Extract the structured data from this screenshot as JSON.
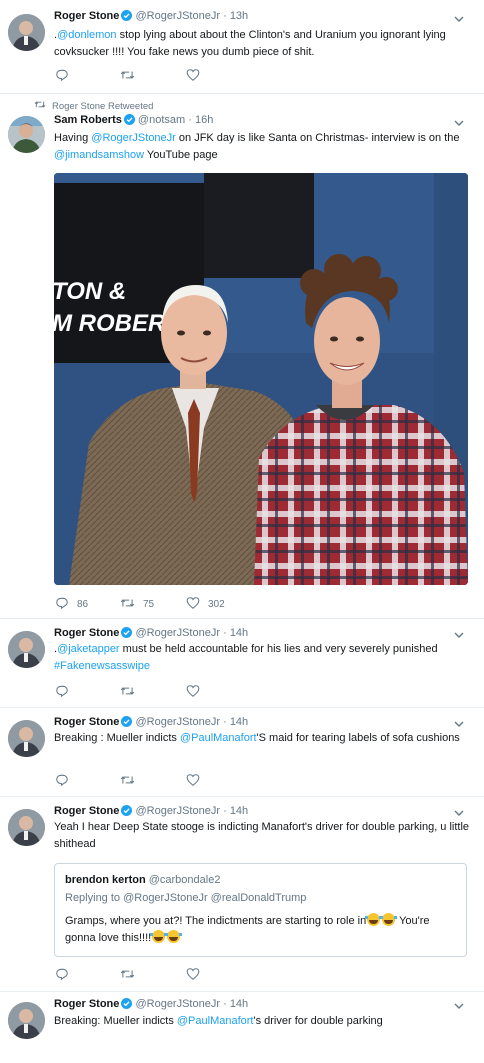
{
  "colors": {
    "link": "#1da1f2",
    "muted": "#657786",
    "text": "#14171a",
    "border": "#e6ecf0",
    "like": "#657786"
  },
  "icons": {
    "reply": "reply-icon",
    "retweet": "retweet-icon",
    "like": "heart-icon",
    "verified": "verified-badge-icon",
    "caret": "chevron-down-icon"
  },
  "tweets": [
    {
      "name": "Roger Stone",
      "handle": "@RogerJStoneJr",
      "dot": "·",
      "time": "13h",
      "parts": [
        {
          "t": ".",
          "link": false
        },
        {
          "t": "@donlemon",
          "link": true
        },
        {
          "t": " stop lying about about the Clinton's and Uranium you ignorant lying covksucker !!!! You fake news you dumb piece of shit.",
          "link": false
        }
      ]
    },
    {
      "retweet_context": "Roger Stone Retweeted",
      "name": "Sam Roberts",
      "handle": "@notsam",
      "dot": "·",
      "time": "16h",
      "parts": [
        {
          "t": "Having ",
          "link": false
        },
        {
          "t": "@RogerJStoneJr",
          "link": true
        },
        {
          "t": " on JFK day is like Santa on Christmas- interview is on the ",
          "link": false
        },
        {
          "t": "@jimandsamshow",
          "link": true
        },
        {
          "t": " YouTube page",
          "link": false
        }
      ],
      "media_sign_text": [
        "TON &",
        "M ROBERT"
      ],
      "counts": {
        "reply": "86",
        "retweet": "75",
        "like": "302"
      }
    },
    {
      "name": "Roger Stone",
      "handle": "@RogerJStoneJr",
      "dot": "·",
      "time": "14h",
      "parts": [
        {
          "t": ".",
          "link": false
        },
        {
          "t": "@jaketapper",
          "link": true
        },
        {
          "t": " must be held accountable for his lies and very severely punished ",
          "link": false
        },
        {
          "t": "#Fakenewsasswipe",
          "link": true
        }
      ]
    },
    {
      "name": "Roger Stone",
      "handle": "@RogerJStoneJr",
      "dot": "·",
      "time": "14h",
      "parts": [
        {
          "t": "Breaking : Mueller indicts ",
          "link": false
        },
        {
          "t": "@PaulManafort",
          "link": true
        },
        {
          "t": "'S maid for tearing labels of sofa cushions",
          "link": false
        }
      ]
    },
    {
      "name": "Roger Stone",
      "handle": "@RogerJStoneJr",
      "dot": "·",
      "time": "14h",
      "parts": [
        {
          "t": "Yeah I hear Deep State stooge is indicting Manafort's driver for double parking, u little shithead",
          "link": false
        }
      ],
      "quote": {
        "name": "brendon kerton",
        "handle": "@carbondale2",
        "replying": "Replying to @RogerJStoneJr @realDonaldTrump",
        "text_a": "Gramps, where you at?! The indictments are starting to role in",
        "text_b": " You're gonna love this!!!!",
        "emoji": "face-with-tears-of-joy"
      }
    },
    {
      "name": "Roger Stone",
      "handle": "@RogerJStoneJr",
      "dot": "·",
      "time": "14h",
      "parts": [
        {
          "t": "Breaking: Mueller indicts ",
          "link": false
        },
        {
          "t": "@PaulManafort",
          "link": true
        },
        {
          "t": "'s driver for double parking",
          "link": false
        }
      ]
    }
  ]
}
